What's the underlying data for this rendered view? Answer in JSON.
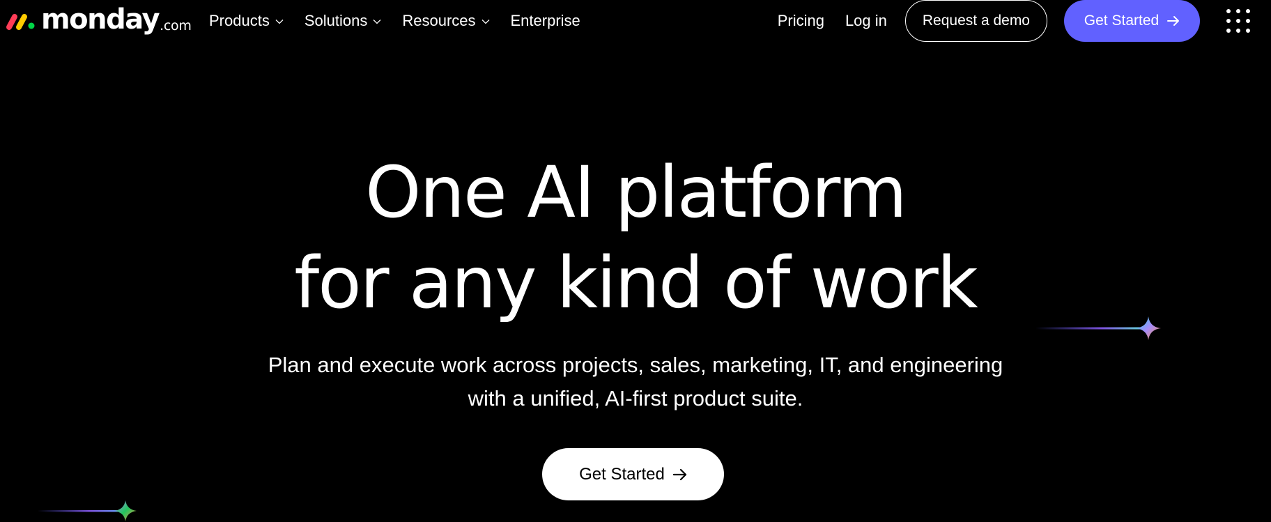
{
  "brand": {
    "wordmark": "monday",
    "tld": ".com",
    "colors": {
      "red": "#ff3d57",
      "yellow": "#ffcb00",
      "green": "#00d647"
    }
  },
  "nav": {
    "links": [
      {
        "label": "Products",
        "has_dropdown": true
      },
      {
        "label": "Solutions",
        "has_dropdown": true
      },
      {
        "label": "Resources",
        "has_dropdown": true
      },
      {
        "label": "Enterprise",
        "has_dropdown": false
      }
    ],
    "pricing": "Pricing",
    "login": "Log in",
    "request_demo": "Request a demo",
    "get_started": "Get Started",
    "menu_icon": "grid-dots-icon"
  },
  "hero": {
    "title_line1": "One AI platform",
    "title_line2": "for any kind of work",
    "subtitle_line1": "Plan and execute work across projects, sales, marketing, IT, and engineering",
    "subtitle_line2": "with a unified, AI-first product suite.",
    "cta": "Get Started"
  },
  "colors": {
    "background": "#000000",
    "primary": "#6161ff",
    "text": "#ffffff"
  }
}
